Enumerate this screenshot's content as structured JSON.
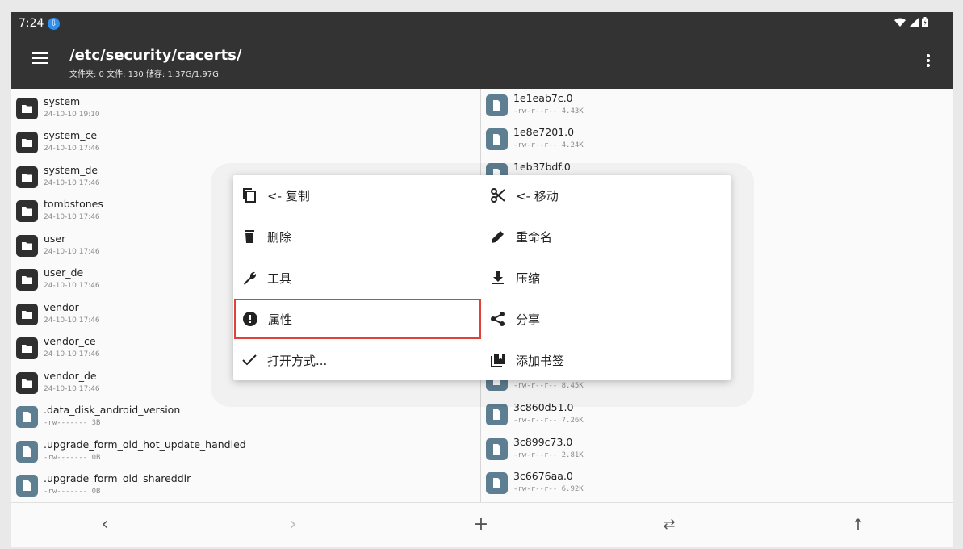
{
  "status": {
    "time": "7:24",
    "download_badge": "⇩"
  },
  "header": {
    "path": "/etc/security/cacerts/",
    "info": "文件夹: 0  文件: 130  储存: 1.37G/1.97G"
  },
  "left_list": [
    {
      "name": "system",
      "meta": "24-10-10 19:10",
      "type": "folder"
    },
    {
      "name": "system_ce",
      "meta": "24-10-10 17:46",
      "type": "folder"
    },
    {
      "name": "system_de",
      "meta": "24-10-10 17:46",
      "type": "folder"
    },
    {
      "name": "tombstones",
      "meta": "24-10-10 17:46",
      "type": "folder"
    },
    {
      "name": "user",
      "meta": "24-10-10 17:46",
      "type": "folder"
    },
    {
      "name": "user_de",
      "meta": "24-10-10 17:46",
      "type": "folder"
    },
    {
      "name": "vendor",
      "meta": "24-10-10 17:46",
      "type": "folder"
    },
    {
      "name": "vendor_ce",
      "meta": "24-10-10 17:46",
      "type": "folder"
    },
    {
      "name": "vendor_de",
      "meta": "24-10-10 17:46",
      "type": "folder"
    },
    {
      "name": ".data_disk_android_version",
      "meta": "-rw-------  3B",
      "type": "file"
    },
    {
      "name": ".upgrade_form_old_hot_update_handled",
      "meta": "-rw-------  0B",
      "type": "file"
    },
    {
      "name": ".upgrade_form_old_shareddir",
      "meta": "-rw-------  0B",
      "type": "file"
    }
  ],
  "right_list_top": [
    {
      "name": "1e1eab7c.0",
      "meta": "-rw-r--r--  4.43K"
    },
    {
      "name": "1e8e7201.0",
      "meta": "-rw-r--r--  4.24K"
    },
    {
      "name": "1eb37bdf.0",
      "meta": ""
    }
  ],
  "right_list_bottom": [
    {
      "name": "",
      "meta": "-rw-r--r--  8.45K"
    },
    {
      "name": "3c860d51.0",
      "meta": "-rw-r--r--  7.26K"
    },
    {
      "name": "3c899c73.0",
      "meta": "-rw-r--r--  2.81K"
    },
    {
      "name": "3c6676aa.0",
      "meta": "-rw-r--r--  6.92K"
    }
  ],
  "menu": {
    "copy": "<- 复制",
    "move": "<- 移动",
    "delete": "删除",
    "rename": "重命名",
    "tools": "工具",
    "compress": "压缩",
    "properties": "属性",
    "share": "分享",
    "open_with": "打开方式...",
    "bookmark": "添加书签"
  },
  "bottom": {
    "back": "‹",
    "forward": "›",
    "add": "+",
    "swap": "⇄",
    "up": "↑"
  }
}
